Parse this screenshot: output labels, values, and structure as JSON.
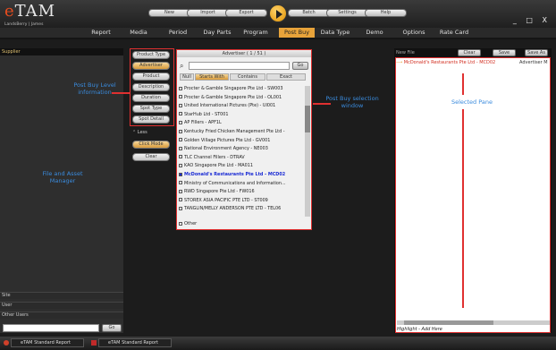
{
  "app": {
    "logo_prefix": "e",
    "logo_main": "TAM",
    "logo_sub": "LandsBerry | James"
  },
  "toolbar": {
    "buttons": [
      "New",
      "Import",
      "Export",
      "Batch",
      "Settings",
      "Help"
    ]
  },
  "window_controls": "_ □ X",
  "menu": {
    "items": [
      "Report",
      "Media",
      "Period",
      "Day Parts",
      "Program",
      "Post Buy",
      "Data Type",
      "Demo",
      "Options",
      "Rate Card"
    ],
    "active": "Post Buy"
  },
  "left_panel": {
    "header": "Supplier",
    "rows": [
      "Site",
      "User",
      "Other Users"
    ],
    "go_label": "Go"
  },
  "post_buy_levels": {
    "buttons": [
      "Product Type",
      "Advertiser",
      "Product",
      "Description",
      "Duration",
      "Spot Type",
      "Spot Detail"
    ],
    "selected": "Advertiser",
    "less_label": "Less",
    "click_mode": "Click Mode",
    "clear": "Clear"
  },
  "selection_window": {
    "title": "Advertiser ( 1 / 51 )",
    "go_label": "Go",
    "tabs": [
      "Null",
      "Starts With",
      "Contains",
      "Exact"
    ],
    "selected_tab": "Starts With",
    "items": [
      "Procter & Gamble Singapore Pte Ltd - SW003",
      "Procter & Gamble Singapore Pte Ltd - OL001",
      "United International Pictures (Pte) - UI001",
      "StarHub Ltd - ST001",
      "AP Fillers - APF1L",
      "Kentucky Fried Chicken Management Pte Ltd -",
      "Golden Village Pictures Pte Ltd - GV001",
      "National Environment Agency - NE003",
      "TLC Channel Fillers - DTRAV",
      "KAO Singapore Pte Ltd - MA011",
      "McDonald's Restaurants Pte Ltd - MCD02",
      "Ministry of Communications and Information...",
      "RWD Singapore Pte Ltd - FW016",
      "STOREX ASIA PACIFIC PTE LTD - ST009",
      "TANGLIN/MELLY ANDERSON PTE LTD - TEL06"
    ],
    "highlighted_index": 10,
    "other_label": "Other"
  },
  "right_panel": {
    "new_file": "New File",
    "buttons": [
      "Clear",
      "Save",
      "Save As"
    ],
    "selected_item": "McDonald's Restaurants Pte Ltd - MCD02",
    "selected_col2": "Advertiser M",
    "footer": "Highlight - Add Here"
  },
  "annotations": {
    "file_asset": "File and Asset\nManager",
    "post_buy_level": "Post Buy Level\ninformation",
    "post_buy_sel": "Post Buy selection\nwindow",
    "selected_pane": "Selected Pane"
  },
  "taskbar": {
    "items": [
      "eTAM Standard Report",
      "eTAM Standard Report"
    ]
  },
  "colors": {
    "accent": "#e8a33a",
    "annotation_red": "#e03030",
    "annotation_blue": "#3a8bdd",
    "highlight_blue": "#1a2bd4",
    "selected_red": "#d22d1f"
  }
}
